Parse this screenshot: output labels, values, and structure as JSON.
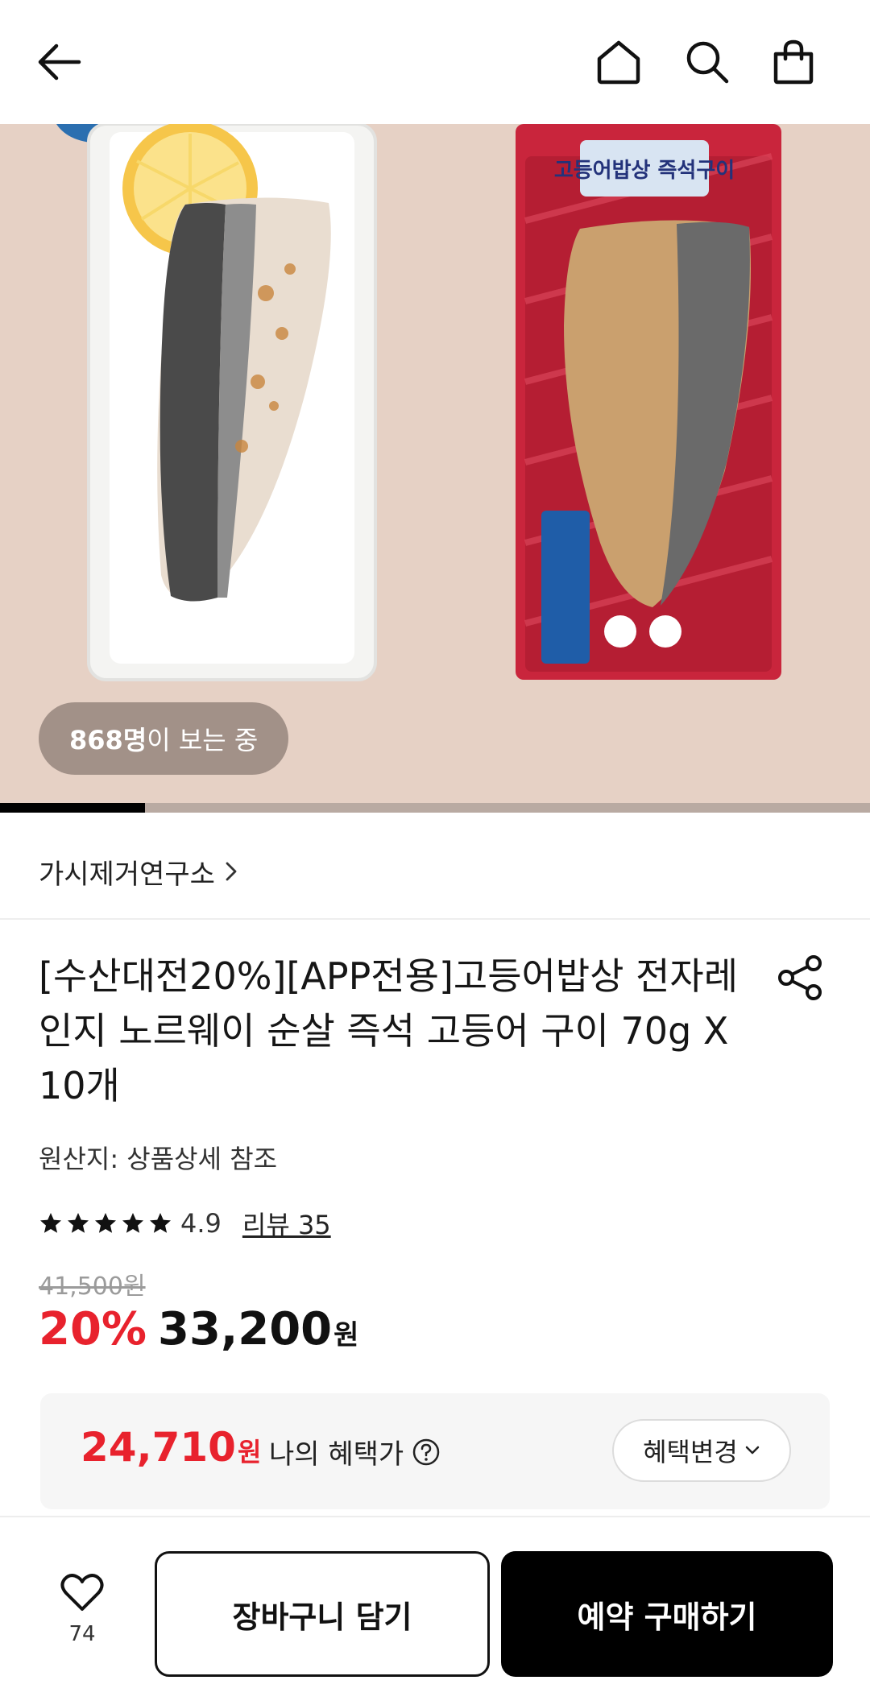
{
  "header": {
    "back_icon": "arrow-left-icon",
    "home_icon": "home-icon",
    "search_icon": "search-icon",
    "cart_icon": "shopping-bag-icon"
  },
  "hero": {
    "package_text": "고등어밥상 즉석구이",
    "viewers_count": "868명",
    "viewers_suffix": "이 보는 중",
    "slide_progress": 0.167
  },
  "brand": {
    "name": "가시제거연구소",
    "chevron_icon": "chevron-right-icon"
  },
  "product": {
    "title": "[수산대전20%][APP전용]고등어밥상 전자레인지 노르웨이 순살 즉석 고등어 구이 70g X 10개",
    "share_icon": "share-icon",
    "origin": "원산지: 상품상세 참조",
    "rating": "4.9",
    "stars": 5,
    "review_link": "리뷰 35"
  },
  "price": {
    "original": "41,500원",
    "discount": "20%",
    "sale": "33,200",
    "unit": "원"
  },
  "benefit": {
    "price": "24,710",
    "unit": "원",
    "label": "나의 혜택가",
    "help_icon": "question-circle-icon",
    "change_label": "혜택변경"
  },
  "bottom": {
    "wish_icon": "heart-icon",
    "wish_count": "74",
    "cart_label": "장바구니 담기",
    "buy_label": "예약 구매하기"
  },
  "colors": {
    "accent_red": "#e8222d",
    "primary_black": "#000000"
  }
}
